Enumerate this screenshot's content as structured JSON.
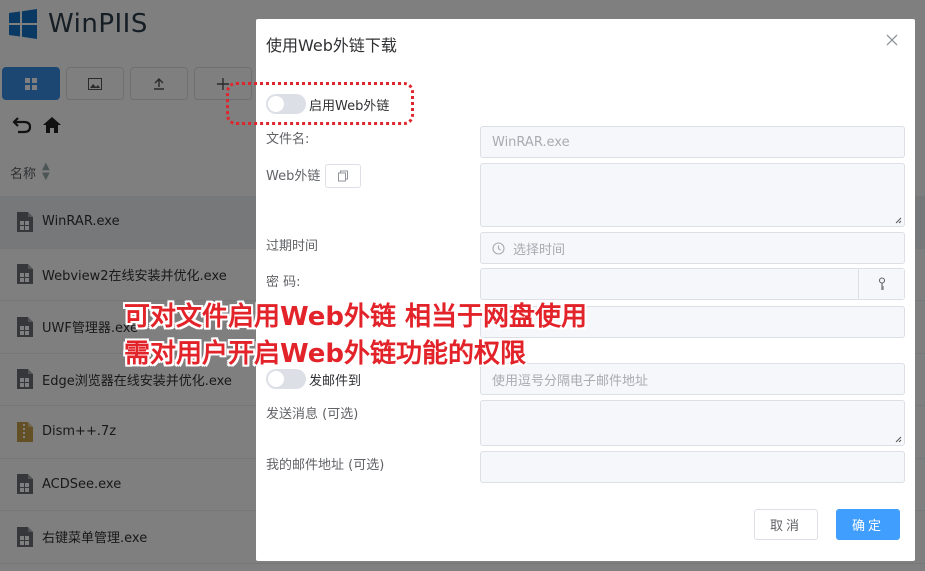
{
  "app": {
    "title": "WinPIIS",
    "column_name_label": "名称",
    "files": [
      {
        "name": "WinRAR.exe",
        "type": "exe"
      },
      {
        "name": "Webview2在线安装并优化.exe",
        "type": "exe"
      },
      {
        "name": "UWF管理器.exe",
        "type": "exe"
      },
      {
        "name": "Edge浏览器在线安装并优化.exe",
        "type": "exe"
      },
      {
        "name": "Dism++.7z",
        "type": "archive"
      },
      {
        "name": "ACDSee.exe",
        "type": "exe"
      },
      {
        "name": "右键菜单管理.exe",
        "type": "exe"
      }
    ]
  },
  "dialog": {
    "title": "使用Web外链下载",
    "enable_link_label": "启用Web外链",
    "filename_label": "文件名:",
    "filename_value": "WinRAR.exe",
    "weblink_label": "Web外链",
    "expire_label": "过期时间",
    "expire_placeholder": "选择时间",
    "password_label": "密 码:",
    "mail_toggle_label": "发邮件到",
    "mail_placeholder": "使用逗号分隔电子邮件地址",
    "message_label": "发送消息 (可选)",
    "my_email_label": "我的邮件地址 (可选)",
    "cancel_label": "取消",
    "ok_label": "确定"
  },
  "annotations": {
    "line1": "可对文件启用Web外链 相当于网盘使用",
    "line2": "需对用户开启Web外链功能的权限"
  },
  "colors": {
    "primary": "#409eff",
    "annotation_red": "#e3232a",
    "toolbar_active": "#3a8ee6"
  },
  "icons": {
    "toolbar": [
      "grid-icon",
      "image-icon",
      "upload-icon",
      "plus-icon",
      "star-icon"
    ],
    "nav": [
      "back-icon",
      "home-icon"
    ]
  }
}
